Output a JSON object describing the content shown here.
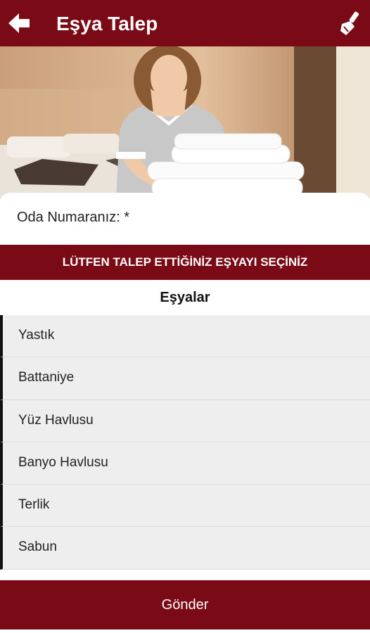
{
  "colors": {
    "primary": "#7b0a17",
    "list_bg": "#eeeeee",
    "list_accent": "#111111"
  },
  "appbar": {
    "title": "Eşya Talep",
    "back_icon": "arrow-left-icon",
    "action_icon": "paint-brush-icon"
  },
  "hero": {
    "image": "housekeeper-with-towels-photo"
  },
  "form": {
    "room_label": "Oda Numaranız: *"
  },
  "banner": {
    "text": "LÜTFEN TALEP ETTİĞİNİZ EŞYAYI SEÇİNİZ"
  },
  "list": {
    "header": "Eşyalar",
    "items": [
      {
        "label": "Yastık"
      },
      {
        "label": "Battaniye"
      },
      {
        "label": "Yüz Havlusu"
      },
      {
        "label": "Banyo Havlusu"
      },
      {
        "label": "Terlik"
      },
      {
        "label": "Sabun"
      }
    ]
  },
  "submit": {
    "label": "Gönder"
  }
}
